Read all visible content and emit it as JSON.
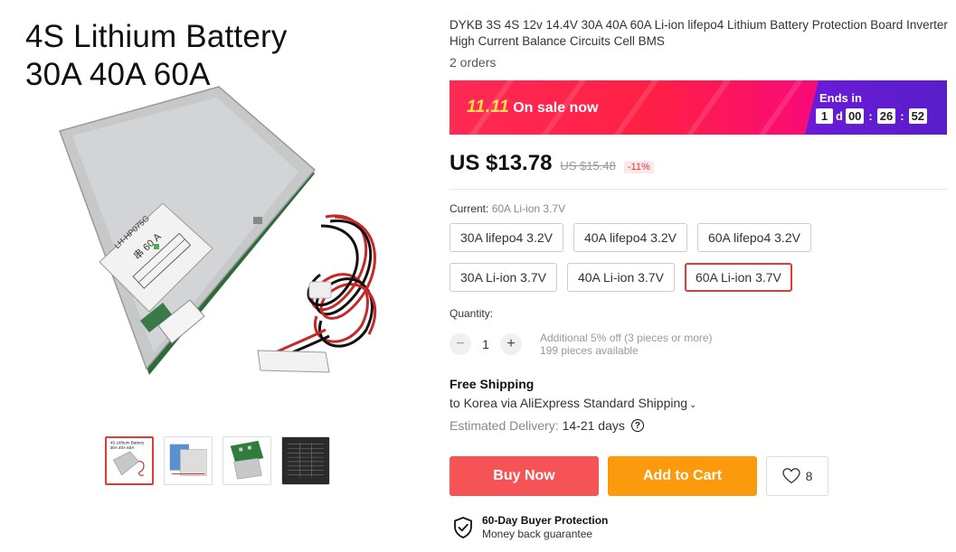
{
  "gallery": {
    "hero_line1": "4S Lithium Battery",
    "hero_line2": "30A 40A 60A",
    "board_text_model": "LH-HP075G",
    "board_text_rating": "串 60 A",
    "thumb1_line1": "4S Lithium Battery",
    "thumb1_line2": "30A 40A 60A"
  },
  "product": {
    "title": "DYKB 3S 4S 12v 14.4V 30A 40A 60A Li-ion lifepo4 Lithium Battery Protection Board Inverter High Current Balance Circuits Cell BMS",
    "orders": "2 orders"
  },
  "promo": {
    "tag_num": "11.11",
    "tag_text": "On sale now",
    "ends_label": "Ends in",
    "days": "1",
    "days_unit": "d",
    "hours": "00",
    "minutes": "26",
    "seconds": "52",
    "colors": {
      "sale_start": "#ff2a55",
      "sale_end": "#f80a7a",
      "timer_bg": "#5a1dc9"
    }
  },
  "pricing": {
    "price": "US $13.78",
    "old_price": "US $15.48",
    "discount": "-11%"
  },
  "sku": {
    "current_label": "Current:",
    "current_value": "60A Li-ion 3.7V",
    "row1": [
      "30A lifepo4 3.2V",
      "40A lifepo4 3.2V",
      "60A lifepo4 3.2V"
    ],
    "row2": [
      "30A Li-ion 3.7V",
      "40A Li-ion 3.7V",
      "60A Li-ion 3.7V"
    ]
  },
  "quantity": {
    "label": "Quantity:",
    "minus": "−",
    "value": "1",
    "plus": "+",
    "additional": "Additional 5% off (3 pieces or more)",
    "available": "199 pieces available"
  },
  "shipping": {
    "title": "Free Shipping",
    "line": "to Korea via AliExpress Standard Shipping",
    "eta_label": "Estimated Delivery:",
    "eta_days": "14-21 days",
    "help": "?"
  },
  "actions": {
    "buy": "Buy Now",
    "cart": "Add to Cart",
    "wish_count": "8",
    "colors": {
      "buy": "#f55356",
      "cart": "#fb9a0c"
    }
  },
  "protection": {
    "title": "60-Day Buyer Protection",
    "subtitle": "Money back guarantee"
  }
}
